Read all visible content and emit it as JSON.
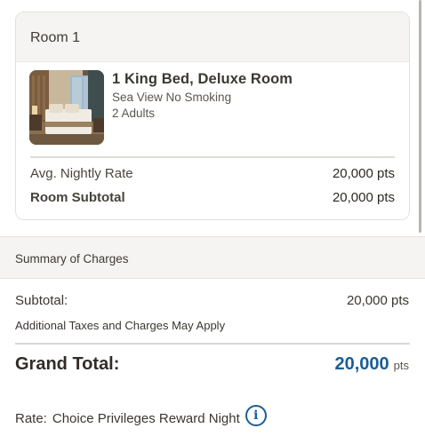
{
  "room_card": {
    "header": "Room 1",
    "room_title": "1 King Bed, Deluxe Room",
    "room_view": "Sea View No Smoking",
    "guests": "2 Adults",
    "avg_rate_label": "Avg. Nightly Rate",
    "avg_rate_value": "20,000 pts",
    "subtotal_label": "Room Subtotal",
    "subtotal_value": "20,000 pts"
  },
  "summary": {
    "header": "Summary of Charges",
    "subtotal_label": "Subtotal:",
    "subtotal_value": "20,000 pts",
    "taxes_note": "Additional Taxes and Charges May Apply",
    "grand_total_label": "Grand Total:",
    "grand_total_amount": "20,000",
    "grand_total_unit": "pts",
    "rate_label": "Rate:",
    "rate_name": "Choice Privileges Reward Night",
    "info_glyph": "i"
  },
  "colors": {
    "accent": "#1b5e96",
    "header_bg": "#f5f4f2",
    "text": "#3d3a34"
  }
}
